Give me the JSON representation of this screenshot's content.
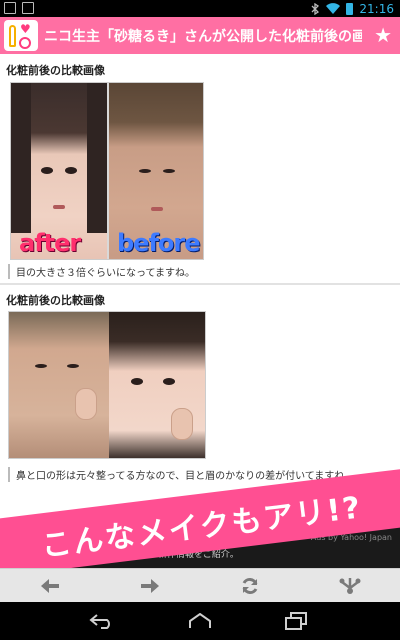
{
  "status_bar": {
    "time": "21:16",
    "left_icons": [
      "gallery-notification-icon",
      "image-notification-icon"
    ],
    "right_icons": [
      "bluetooth-icon",
      "wifi-icon",
      "battery-icon"
    ],
    "accent": "#33b5e5"
  },
  "app_header": {
    "title": "ニコ生主「砂糖るき」さんが公開した化粧前後の画",
    "star_icon": "star-icon",
    "bg_color": "#ff6fa3"
  },
  "sections": [
    {
      "title": "化粧前後の比較画像",
      "image_labels": [
        "after",
        "before"
      ],
      "caption": "目の大きさ３倍ぐらいになってますね。"
    },
    {
      "title": "化粧前後の比較画像",
      "caption": "鼻と口の形は元々整ってる方なので、目と眉のかなりの差が付いてますね。"
    }
  ],
  "ad": {
    "text": "ジュエリー・トレンドコレクション、新作情報をご紹介。",
    "attribution": "Ads by Yahoo! Japan"
  },
  "banner": {
    "text": "こんなメイクもアリ!?",
    "color": "#ff4f92"
  },
  "toolbar": {
    "buttons": [
      "back-arrow-icon",
      "forward-arrow-icon",
      "refresh-icon",
      "share-icon"
    ]
  },
  "navbar": {
    "buttons": [
      "back-icon",
      "home-icon",
      "recent-apps-icon"
    ]
  }
}
